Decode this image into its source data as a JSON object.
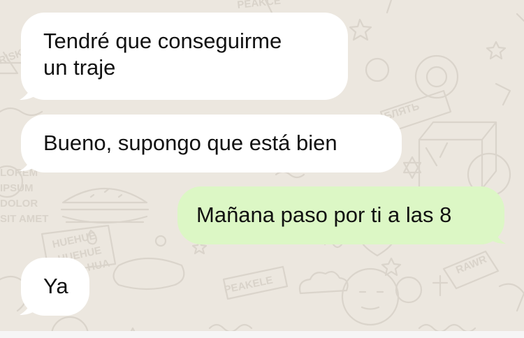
{
  "colors": {
    "wallpaper": "#ece7df",
    "doodle_stroke": "#d9d3ca",
    "incoming_bubble": "#ffffff",
    "outgoing_bubble": "#dcf7c5",
    "message_text": "#111111"
  },
  "messages": [
    {
      "direction": "incoming",
      "lines": [
        "Tendré que conseguirme",
        "un traje"
      ]
    },
    {
      "direction": "incoming",
      "lines": [
        "Bueno, supongo que está bien"
      ]
    },
    {
      "direction": "outgoing",
      "lines": [
        "Mañana paso por ti a las 8"
      ]
    },
    {
      "direction": "incoming",
      "lines": [
        "Ya"
      ]
    }
  ],
  "wallpaper_doodle_text": [
    "PEAKCE",
    "LOREM",
    "IPSUM",
    "DOLOR",
    "SIT AMET",
    "HUEHUE",
    "HUEHUE",
    "HUA",
    "БЛЯТЬ",
    "RAWR",
    "PEAKELE",
    "RISKOM"
  ]
}
